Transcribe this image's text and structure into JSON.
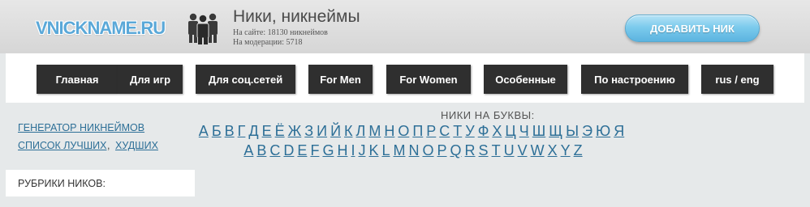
{
  "header": {
    "logo": "VNICKNAME.RU",
    "site_title": "Ники, никнеймы",
    "stats": [
      {
        "label": "На сайте:",
        "value": "18130 никнеймов"
      },
      {
        "label": "На модерации:",
        "value": "5718"
      }
    ],
    "add_button": "ДОБАВИТЬ НИК",
    "icon": "people-group-icon"
  },
  "nav": [
    {
      "label": "Главная",
      "name": "nav-home"
    },
    {
      "label": "Для игр",
      "name": "nav-games"
    },
    {
      "label": "Для соц.сетей",
      "name": "nav-social"
    },
    {
      "label": "For Men",
      "name": "nav-for-men"
    },
    {
      "label": "For Women",
      "name": "nav-for-women"
    },
    {
      "label": "Особенные",
      "name": "nav-special"
    },
    {
      "label": "По настроению",
      "name": "nav-mood"
    },
    {
      "label": "rus / eng",
      "name": "nav-language"
    }
  ],
  "left_links": {
    "generator": "Генератор никнеймов",
    "best": "Список лучших",
    "comma": ",",
    "worst": "худших"
  },
  "letters": {
    "heading": "НИКИ НА БУКВЫ:",
    "cyrillic": [
      "А",
      "Б",
      "В",
      "Г",
      "Д",
      "Е",
      "Ё",
      "Ж",
      "З",
      "И",
      "Й",
      "К",
      "Л",
      "М",
      "Н",
      "О",
      "П",
      "Р",
      "С",
      "Т",
      "У",
      "Ф",
      "Х",
      "Ц",
      "Ч",
      "Ш",
      "Щ",
      "Ы",
      "Э",
      "Ю",
      "Я"
    ],
    "latin": [
      "A",
      "B",
      "C",
      "D",
      "E",
      "F",
      "G",
      "H",
      "I",
      "J",
      "K",
      "L",
      "M",
      "N",
      "O",
      "P",
      "Q",
      "R",
      "S",
      "T",
      "U",
      "V",
      "W",
      "X",
      "Y",
      "Z"
    ]
  },
  "rubrics": {
    "title": "РУБРИКИ НИКОВ:"
  },
  "colors": {
    "link": "#2d6f97",
    "nav_bg": "#2f2f2f",
    "button_accent": "#7ccbed"
  }
}
